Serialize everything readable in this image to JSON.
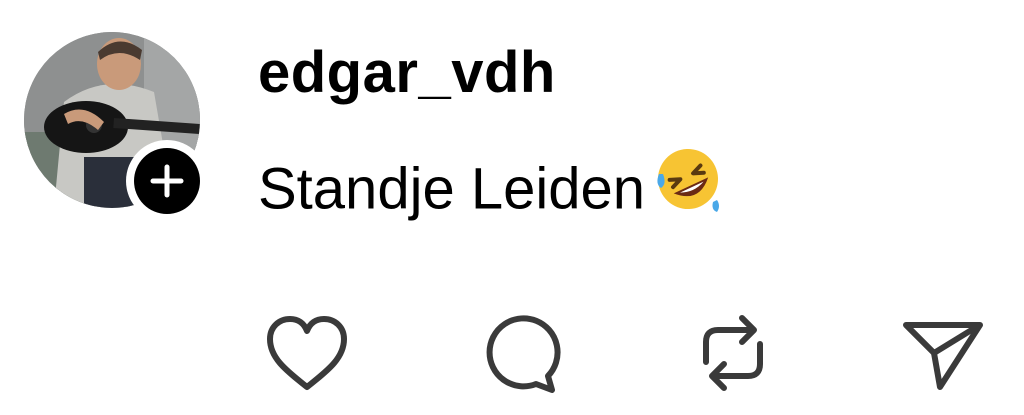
{
  "post": {
    "username": "edgar_vdh",
    "caption": "Standje Leiden"
  },
  "icons": {
    "avatar": "profile-photo",
    "follow": "plus-icon",
    "caption_emoji": "rolling-on-floor-laughing-emoji",
    "like": "heart-icon",
    "comment": "comment-bubble-icon",
    "repost": "repost-icon",
    "share": "send-icon"
  },
  "colors": {
    "text": "#000000",
    "icon_stroke": "#3a3a3a",
    "badge": "#000000",
    "background": "#ffffff"
  }
}
